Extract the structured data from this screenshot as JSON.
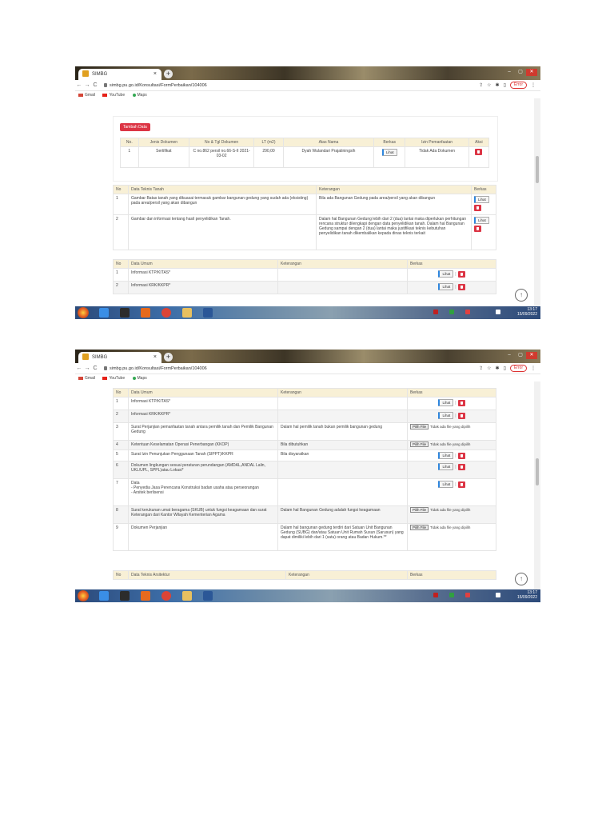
{
  "browser": {
    "tab_title": "SIMBG",
    "tab_close": "×",
    "new_tab": "+",
    "url": "simbg.pu.go.id/Konsultasi/FormPerbaikan/104006",
    "error_label": "Error",
    "bookmarks": [
      "Gmail",
      "YouTube",
      "Maps"
    ]
  },
  "taskbar": {
    "time": "13:17",
    "date": "15/09/2022"
  },
  "shot1": {
    "add_doc_button": "Tambah Data",
    "doc_table": {
      "headers": [
        "No.",
        "Jenis Dokumen",
        "No & Tgl Dokumen",
        "LT (m2)",
        "Atas Nama",
        "Berkas",
        "Izin Pemanfaatan",
        "Aksi"
      ],
      "rows": [
        {
          "no": "1",
          "jenis": "Sertifikat",
          "no_tgl": "C no.862 persil no.66-S-II 2021-03-02",
          "lt": "290,00",
          "atas_nama": "Dyah Wulandari Prajatiningsih",
          "berkas": "Lihat",
          "izin": "Tidak Ada Dokumen"
        }
      ]
    },
    "teknis_tanah": {
      "headers": [
        "No",
        "Data Teknis Tanah",
        "Keterangan",
        "Berkas"
      ],
      "rows": [
        {
          "no": "1",
          "data": "Gambar Batas tanah yang dikuasai termasuk gambar bangunan gedung yang sudah ada (eksisting) pada area/persil yang akan dibangun",
          "ket": "Bila ada Bangunan Gedung pada area/persil yang akan dibangun",
          "berkas": "Lihat"
        },
        {
          "no": "2",
          "data": "Gambar dan informasi tentang hasil penyelidikan Tanah.",
          "ket": "Dalam hal Bangunan Gedung lebih dari 2 (dua) lantai maka diperlukan perhitungan rencana struktur dilengkapi dengan data penyelidikan tanah. Dalam hal Bangunan Gedung sampai dengan 2 (dua) lantai maka justifikasi teknis kebutuhan penyelidikan tanah dikembalikan kepada dinas teknis terkait",
          "berkas": "Lihat"
        }
      ]
    },
    "data_umum": {
      "headers": [
        "No",
        "Data Umum",
        "Keterangan",
        "Berkas"
      ],
      "rows": [
        {
          "no": "1",
          "data": "Informasi KTP/KITAS*",
          "ket": "",
          "berkas": "Lihat"
        },
        {
          "no": "2",
          "data": "Informasi KRK/KKPR*",
          "ket": "",
          "berkas": "Lihat"
        }
      ]
    }
  },
  "shot2": {
    "data_umum": {
      "headers": [
        "No",
        "Data Umum",
        "Keterangan",
        "Berkas"
      ],
      "rows": [
        {
          "no": "1",
          "data": "Informasi KTP/KITAS*",
          "ket": "",
          "type": "lihat"
        },
        {
          "no": "2",
          "data": "Informasi KRK/KKPR*",
          "ket": "",
          "type": "lihat"
        },
        {
          "no": "3",
          "data": "Surat Perjanjian pemanfaatan tanah antara pemilik tanah dan Pemilik Bangunan Gedung",
          "ket": "Dalam hal pemilik tanah bukan pemilik bangunan gedung",
          "type": "upload"
        },
        {
          "no": "4",
          "data": "Ketentuan Keselamatan Operasi Penerbangan (KKOP)",
          "ket": "Bila dibutuhkan",
          "type": "upload"
        },
        {
          "no": "5",
          "data": "Surat Izin Penunjukan Penggunaan Tanah (SIPPT)/KKPR",
          "ket": "Bila disyaratkan",
          "type": "lihat"
        },
        {
          "no": "6",
          "data": "Dokumen lingkungan sesuai peraturan perundangan (AMDAL,ANDAL Lalin, UKL/UPL, SPPL)atau Lokasi*",
          "ket": "",
          "type": "lihat"
        },
        {
          "no": "7",
          "data": "Data\n- Penyedia Jasa Perencana Konstruksi badan usaha atau perseorangan\n- Arsitek berlisensi",
          "ket": "",
          "type": "lihat"
        },
        {
          "no": "8",
          "data": "Surat kerukunan umat beragama (SKUB) untuk fungsi keagamaan dan surat Keterangan dari Kantor Wilayah Kementerian Agama",
          "ket": "Dalam hal Bangunan Gedung adalah fungsi keagamaan",
          "type": "upload"
        },
        {
          "no": "9",
          "data": "Dokumen Perjanjian",
          "ket": "Dalam hal bangunan gedung terdiri dari Satuan Unit Bangunan Gedung (SUBG) dan/atau Satuan Unit Rumah Susun (Sarusun) yang dapat dimiliki lebih dari 1 (satu) orang atau Badan Hukum.**",
          "type": "upload"
        }
      ]
    },
    "next_header": [
      "No",
      "Data Teknis Arsitektur",
      "Keterangan",
      "Berkas"
    ]
  },
  "labels": {
    "lihat": "Lihat",
    "pilih_file": "Pilih File",
    "no_file": "Tidak ada file yang dipilih",
    "sep": "|",
    "up_arrow": "↑"
  }
}
